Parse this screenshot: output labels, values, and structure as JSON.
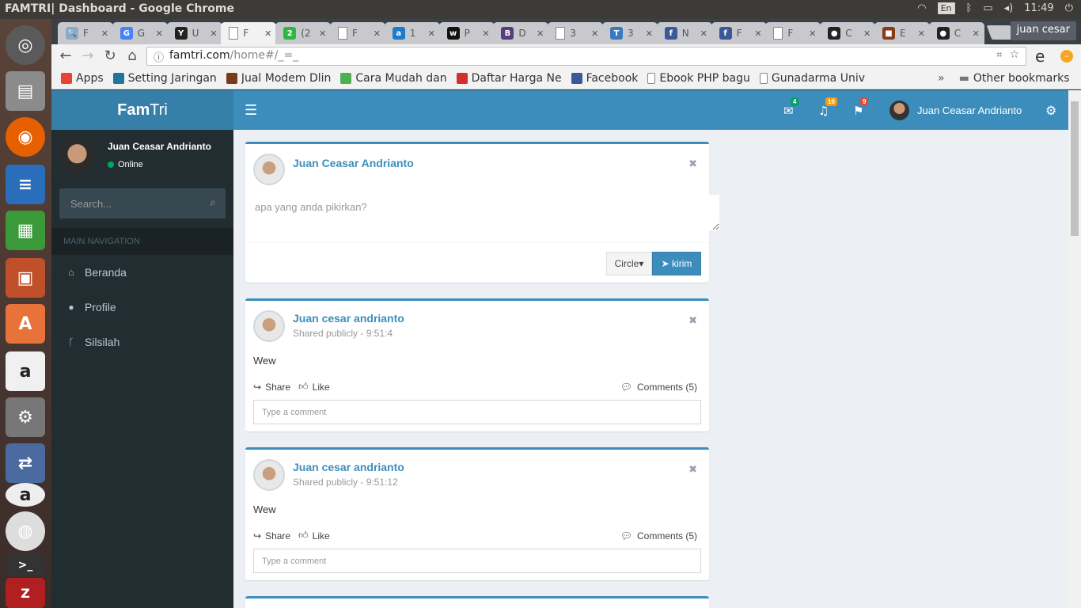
{
  "os": {
    "window_title": "FAMTRI| Dashboard - Google Chrome",
    "keyboard": "En",
    "clock": "11:49",
    "user": "juan cesar"
  },
  "browser": {
    "tabs": [
      {
        "short": "F",
        "color": "#8fa9c8",
        "glyph": "🔍"
      },
      {
        "short": "G",
        "color": "#4285f4",
        "glyph": "G"
      },
      {
        "short": "U",
        "color": "#222",
        "glyph": "Y"
      },
      {
        "short": "F",
        "color": "#ffffff",
        "glyph": "",
        "active": true
      },
      {
        "short": "(2",
        "color": "#2db742",
        "glyph": "2"
      },
      {
        "short": "F",
        "color": "#ffffff",
        "glyph": ""
      },
      {
        "short": "1",
        "color": "#1f7ac9",
        "glyph": "a"
      },
      {
        "short": "P",
        "color": "#111",
        "glyph": "w"
      },
      {
        "short": "D",
        "color": "#563d7c",
        "glyph": "B"
      },
      {
        "short": "3",
        "color": "#ffffff",
        "glyph": ""
      },
      {
        "short": "3",
        "color": "#3b78c2",
        "glyph": "T"
      },
      {
        "short": "N",
        "color": "#3b5998",
        "glyph": "f"
      },
      {
        "short": "F",
        "color": "#3b5998",
        "glyph": "f"
      },
      {
        "short": "F",
        "color": "#ffffff",
        "glyph": ""
      },
      {
        "short": "C",
        "color": "#222",
        "glyph": "●"
      },
      {
        "short": "E",
        "color": "#8a3a1a",
        "glyph": "■"
      },
      {
        "short": "C",
        "color": "#222",
        "glyph": "●"
      }
    ],
    "url_host": "famtri.com",
    "url_path": "/home#/_=_",
    "bookmarks": [
      {
        "label": "Apps",
        "color": "#e94335"
      },
      {
        "label": "Setting Jaringan",
        "color": "#21759b"
      },
      {
        "label": "Jual Modem Dlin",
        "color": "#7a3b1a"
      },
      {
        "label": "Cara Mudah dan",
        "color": "#4caf50"
      },
      {
        "label": "Daftar Harga Ne",
        "color": "#d32f2f"
      },
      {
        "label": "Facebook",
        "color": "#3b5998"
      },
      {
        "label": "Ebook PHP bagu",
        "color": "#ffffff"
      },
      {
        "label": "Gunadarma Univ",
        "color": "#ffffff"
      }
    ],
    "other_bookmarks": "Other bookmarks",
    "more": "»"
  },
  "app": {
    "logo_bold": "Fam",
    "logo_light": "Tri",
    "nav": {
      "messages_count": "4",
      "notifications_count": "10",
      "tasks_count": "9",
      "user_name": "Juan Ceasar Andrianto"
    },
    "sidebar": {
      "user_name": "Juan Ceasar Andrianto",
      "status": "Online",
      "search_placeholder": "Search...",
      "header": "MAIN NAVIGATION",
      "items": [
        {
          "label": "Beranda",
          "icon": "home-icon"
        },
        {
          "label": "Profile",
          "icon": "user-icon"
        },
        {
          "label": "Silsilah",
          "icon": "branch-icon"
        }
      ]
    },
    "composer": {
      "name": "Juan Ceasar Andrianto",
      "placeholder": "apa yang anda pikirkan?",
      "circle_label": "Circle",
      "send_label": "kirim"
    },
    "posts": [
      {
        "name": "Juan cesar andrianto",
        "meta": "Shared publicly - 9:51:4",
        "body": "Wew",
        "share": "Share",
        "like": "Like",
        "comments": "Comments (5)",
        "comment_placeholder": "Type a comment"
      },
      {
        "name": "Juan cesar andrianto",
        "meta": "Shared publicly - 9:51:12",
        "body": "Wew",
        "share": "Share",
        "like": "Like",
        "comments": "Comments (5)",
        "comment_placeholder": "Type a comment"
      }
    ]
  }
}
